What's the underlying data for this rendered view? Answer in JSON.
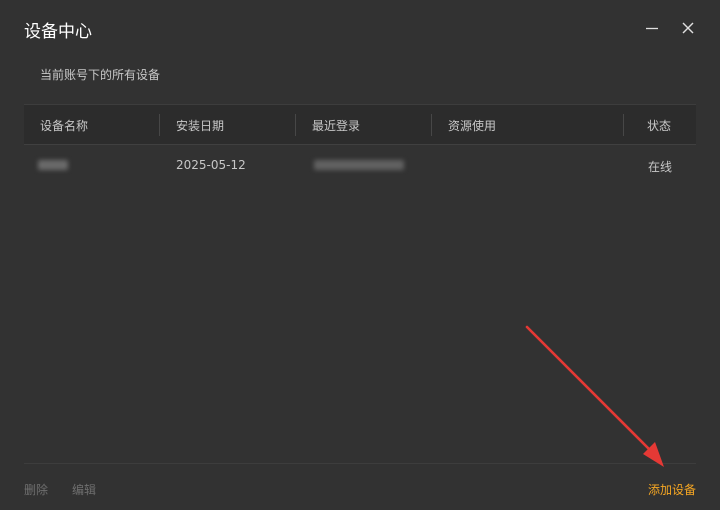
{
  "window": {
    "title": "设备中心"
  },
  "subtitle": "当前账号下的所有设备",
  "table": {
    "columns": [
      "设备名称",
      "安装日期",
      "最近登录",
      "资源使用",
      "状态"
    ],
    "rows": [
      {
        "install_date": "2025-05-12",
        "status": "在线"
      }
    ]
  },
  "footer": {
    "delete_label": "删除",
    "edit_label": "编辑",
    "add_label": "添加设备"
  },
  "colors": {
    "background": "#323232",
    "accent": "#f5a623",
    "annotation_arrow": "#e53935"
  },
  "icons": [
    "minimize-icon",
    "close-icon"
  ]
}
